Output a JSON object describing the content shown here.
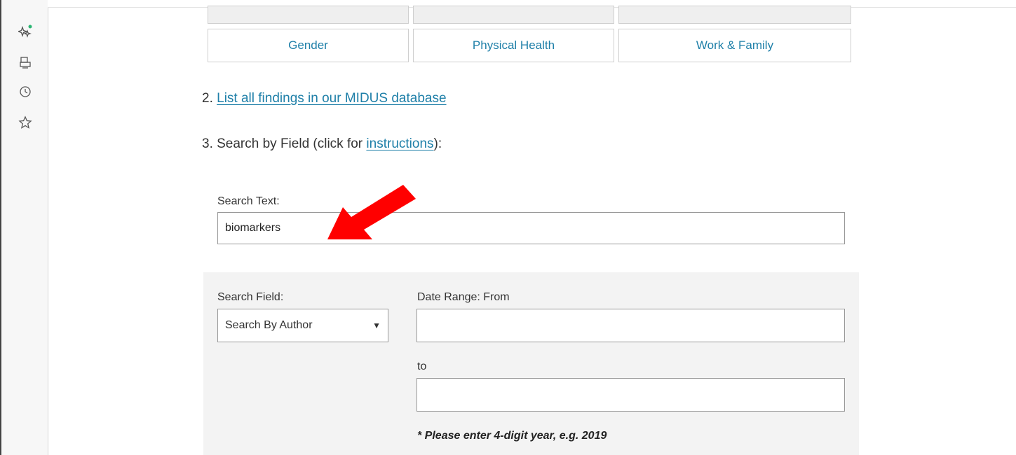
{
  "categories_top": [
    "",
    "",
    ""
  ],
  "categories": [
    "Gender",
    "Physical Health",
    "Work & Family"
  ],
  "item2": {
    "number": "2.",
    "link": "List all findings in our MIDUS database"
  },
  "item3": {
    "prefix": "3. Search by Field (click for ",
    "link": "instructions",
    "suffix": "):"
  },
  "search_text": {
    "label": "Search Text:",
    "value": "biomarkers"
  },
  "search_field": {
    "label": "Search Field:",
    "selected": "Search By Author"
  },
  "date_range": {
    "from_label": "Date Range: From",
    "to_label": "to",
    "from_value": "",
    "to_value": ""
  },
  "note": "* Please enter 4-digit year, e.g. 2019",
  "colors": {
    "link": "#1e7fa8",
    "arrow": "#ff0000",
    "panel": "#f3f3f3"
  },
  "sidebar_icons": [
    "sparkle-icon",
    "briefcase-icon",
    "clock-icon",
    "star-icon"
  ]
}
